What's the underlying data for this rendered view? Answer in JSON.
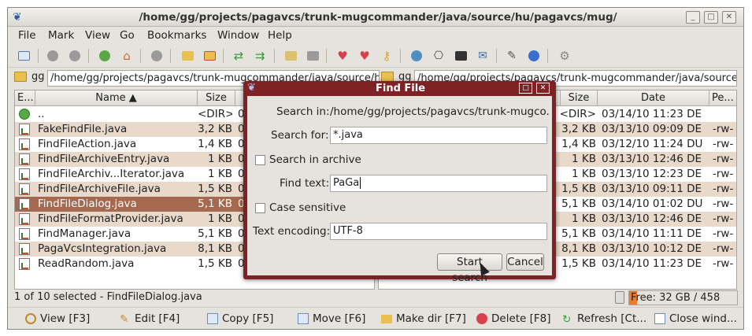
{
  "window": {
    "title": "/home/gg/projects/pagavcs/trunk-mugcommander/java/source/hu/pagavcs/mug/"
  },
  "menu": [
    "File",
    "Mark",
    "View",
    "Go",
    "Bookmarks",
    "Window",
    "Help"
  ],
  "left_panel": {
    "drive": "gg",
    "path": "/home/gg/projects/pagavcs/trunk-mugcommander/java/source/hu/pagavcs/mug/",
    "columns": [
      "E...",
      "Name ▲",
      "Size",
      "0"
    ],
    "rows": [
      {
        "name": "..",
        "size": "<DIR>",
        "date": "0"
      },
      {
        "name": "FakeFindFile.java",
        "size": "3,2 KB",
        "date": "0"
      },
      {
        "name": "FindFileAction.java",
        "size": "1,4 KB",
        "date": "0"
      },
      {
        "name": "FindFileArchiveEntry.java",
        "size": "1 KB",
        "date": "0"
      },
      {
        "name": "FindFileArchiv...Iterator.java",
        "size": "1 KB",
        "date": "0"
      },
      {
        "name": "FindFileArchiveFile.java",
        "size": "1,5 KB",
        "date": "0"
      },
      {
        "name": "FindFileDialog.java",
        "size": "5,1 KB",
        "date": "0"
      },
      {
        "name": "FindFileFormatProvider.java",
        "size": "1 KB",
        "date": "0"
      },
      {
        "name": "FindManager.java",
        "size": "5,1 KB",
        "date": "0"
      },
      {
        "name": "PagaVcsIntegration.java",
        "size": "8,1 KB",
        "date": "0"
      },
      {
        "name": "ReadRandom.java",
        "size": "1,5 KB",
        "date": "0"
      }
    ]
  },
  "right_panel": {
    "drive": "gg",
    "path": "/home/gg/projects/pagavcs/trunk-mugcommander/java/source/h",
    "columns": [
      "Size",
      "Date",
      "Pe..."
    ],
    "hidden_columns": [
      "Date",
      "Pe..",
      "Name ▲"
    ],
    "rows": [
      {
        "size": "<DIR>",
        "date": "03/14/10 11:23 DE",
        "perm": ""
      },
      {
        "size": "3,2 KB",
        "date": "03/13/10 09:09 DE",
        "perm": "-rw-"
      },
      {
        "size": "1,4 KB",
        "date": "03/12/10 11:24 DU",
        "perm": "-rw-"
      },
      {
        "size": "1 KB",
        "date": "03/13/10 12:46 DE",
        "perm": "-rw-"
      },
      {
        "size": "1 KB",
        "date": "03/13/10 12:23 DE",
        "perm": "-rw-"
      },
      {
        "size": "1,5 KB",
        "date": "03/13/10 09:11 DE",
        "perm": "-rw-"
      },
      {
        "size": "5,1 KB",
        "date": "03/14/10 01:02 DU",
        "perm": "-rw-"
      },
      {
        "size": "1 KB",
        "date": "03/13/10 12:46 DE",
        "perm": "-rw-"
      },
      {
        "size": "5,1 KB",
        "date": "03/14/10 11:11 DE",
        "perm": "-rw-"
      },
      {
        "size": "8,1 KB",
        "date": "03/13/10 10:12 DE",
        "perm": "-rw-"
      },
      {
        "size": "1,5 KB",
        "date": "03/14/10 11:23 DE",
        "perm": "-rw-"
      }
    ]
  },
  "status": {
    "selection": "1 of 10 selected - FindFileDialog.java",
    "free": "Free: 32 GB / 458 GB",
    "free_fraction": 0.07
  },
  "bottom_buttons": [
    "View [F3]",
    "Edit [F4]",
    "Copy [F5]",
    "Move [F6]",
    "Make dir [F7]",
    "Delete [F8]",
    "Refresh [Ct...",
    "Close wind..."
  ],
  "dialog": {
    "title": "Find File",
    "search_in_label": "Search in:",
    "search_in_value": "/home/gg/projects/pagavcs/trunk-mugco...",
    "search_for_label": "Search for:",
    "search_for_value": "*.java",
    "search_in_archive": "Search in archive",
    "find_text_label": "Find text:",
    "find_text_value": "PaGa",
    "case_sensitive": "Case sensitive",
    "encoding_label": "Text encoding:",
    "encoding_value": "UTF-8",
    "start_button": "Start search",
    "cancel_button": "Cancel"
  },
  "colors": {
    "row_alt": "#e8d9cb",
    "row_selected": "#a4694f",
    "dialog_frame": "#7e2226",
    "free_bar": "#f07a28"
  }
}
